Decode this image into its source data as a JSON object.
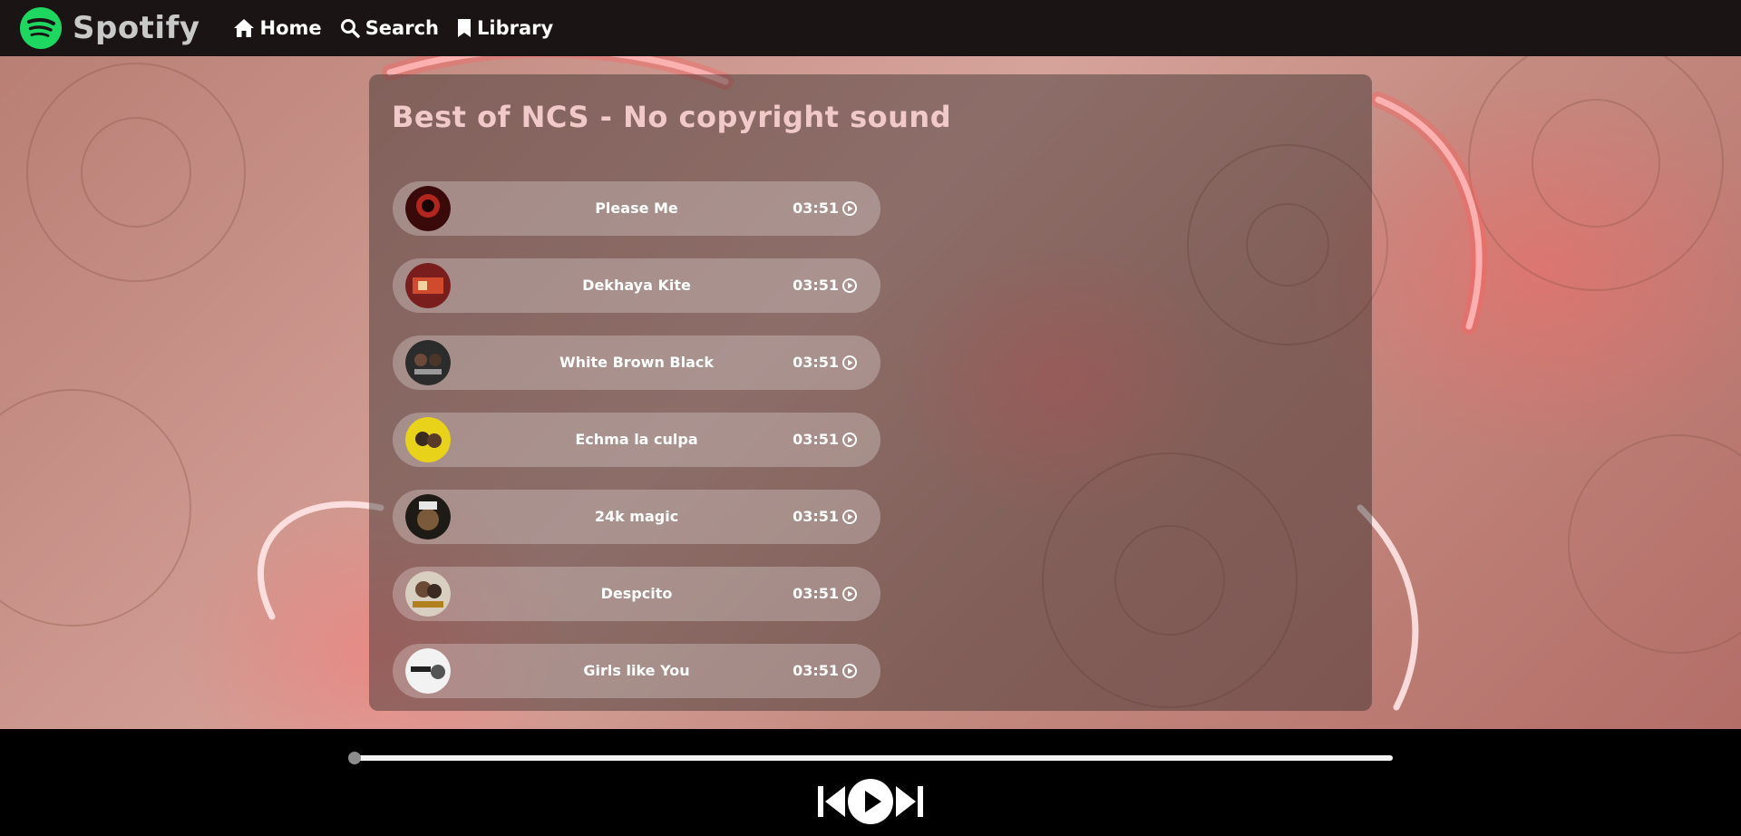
{
  "navbar": {
    "brand": "Spotify",
    "items": [
      {
        "label": "Home",
        "icon": "home-icon"
      },
      {
        "label": "Search",
        "icon": "search-icon"
      },
      {
        "label": "Library",
        "icon": "bookmark-icon"
      }
    ]
  },
  "playlist": {
    "title": "Best of NCS - No copyright sound",
    "songs": [
      {
        "name": "Please Me",
        "duration": "03:51"
      },
      {
        "name": "Dekhaya Kite",
        "duration": "03:51"
      },
      {
        "name": "White Brown Black",
        "duration": "03:51"
      },
      {
        "name": "Echma la culpa",
        "duration": "03:51"
      },
      {
        "name": "24k magic",
        "duration": "03:51"
      },
      {
        "name": "Despcito",
        "duration": "03:51"
      },
      {
        "name": "Girls like You",
        "duration": "03:51"
      }
    ]
  },
  "player": {
    "progress_fraction": 0,
    "controls": [
      "previous-icon",
      "play-icon",
      "next-icon"
    ]
  },
  "colors": {
    "brand_green": "#1ed760",
    "navbar_bg": "#1a1414",
    "title_pink": "#f1c9c9",
    "player_bg": "#000000"
  }
}
